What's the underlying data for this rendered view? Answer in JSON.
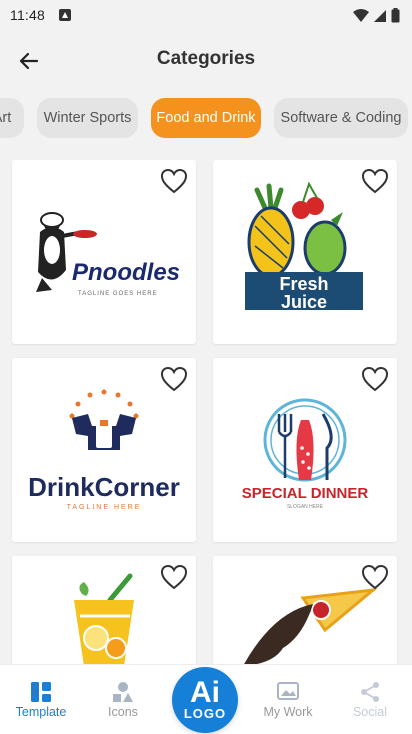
{
  "status_bar": {
    "time": "11:48"
  },
  "header": {
    "title": "Categories"
  },
  "categories": [
    {
      "label": "Art",
      "active": false
    },
    {
      "label": "Winter Sports",
      "active": false
    },
    {
      "label": "Food and Drink",
      "active": true
    },
    {
      "label": "Software & Coding",
      "active": false
    }
  ],
  "logos": [
    {
      "name": "Pnoodles",
      "tagline": "TAGLINE GOES HERE"
    },
    {
      "name_line1": "Fresh",
      "name_line2": "Juice"
    },
    {
      "name": "DrinkCorner",
      "tagline": "TAGLINE HERE"
    },
    {
      "name": "SPECIAL DINNER",
      "tagline": "SLOGAN HERE"
    },
    {
      "name": ""
    },
    {
      "name": ""
    }
  ],
  "bottom_nav": {
    "template": "Template",
    "icons": "Icons",
    "ai_main": "Ai",
    "ai_sub": "LOGO",
    "my_work": "My Work",
    "social": "Social"
  },
  "colors": {
    "accent": "#f5921e",
    "primary": "#1680d9",
    "chip_bg": "#e4e4e4"
  }
}
